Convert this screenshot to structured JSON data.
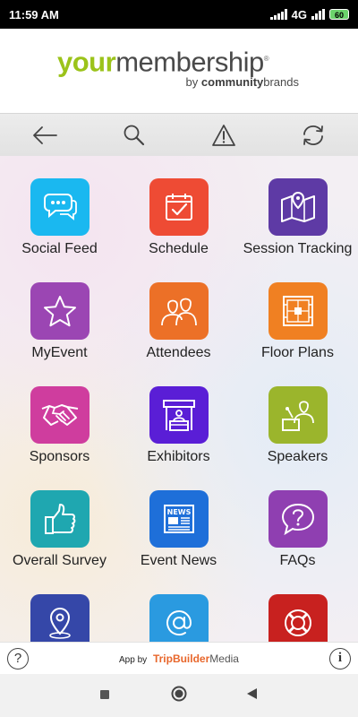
{
  "status": {
    "time": "11:59 AM",
    "network": "4G",
    "battery": "60"
  },
  "header": {
    "logo_your": "your",
    "logo_membership": "membership",
    "logo_by": "by",
    "logo_community": "community",
    "logo_brands": "brands"
  },
  "toolbar": {
    "buttons": [
      "back-arrow-icon",
      "search-icon",
      "warning-icon",
      "refresh-icon"
    ]
  },
  "tiles": [
    {
      "label": "Social Feed",
      "icon": "chat-bubbles-icon",
      "color": "#1ab8f0"
    },
    {
      "label": "Schedule",
      "icon": "calendar-check-icon",
      "color": "#ee4b34"
    },
    {
      "label": "Session Tracking",
      "icon": "map-pin-icon",
      "color": "#5e3aa5"
    },
    {
      "label": "MyEvent",
      "icon": "star-icon",
      "color": "#9b46b3"
    },
    {
      "label": "Attendees",
      "icon": "people-icon",
      "color": "#ec7027"
    },
    {
      "label": "Floor Plans",
      "icon": "floor-plan-icon",
      "color": "#f08022"
    },
    {
      "label": "Sponsors",
      "icon": "handshake-icon",
      "color": "#cf3d9e"
    },
    {
      "label": "Exhibitors",
      "icon": "booth-icon",
      "color": "#5a1ed6"
    },
    {
      "label": "Speakers",
      "icon": "speaker-podium-icon",
      "color": "#9bb52c"
    },
    {
      "label": "Overall Survey",
      "icon": "thumbs-up-icon",
      "color": "#1fa7b0"
    },
    {
      "label": "Event News",
      "icon": "newspaper-icon",
      "color": "#1e6fd9"
    },
    {
      "label": "FAQs",
      "icon": "question-bubble-icon",
      "color": "#8f3fb1"
    },
    {
      "label": "",
      "icon": "location-pin-icon",
      "color": "#3547a8"
    },
    {
      "label": "",
      "icon": "at-sign-icon",
      "color": "#2a9ae0"
    },
    {
      "label": "",
      "icon": "life-ring-icon",
      "color": "#c8211f"
    }
  ],
  "footer": {
    "help": "?",
    "app_by": "App by",
    "brand_trip": "TripBuilder",
    "brand_media": "Media",
    "info": "i"
  },
  "nav": {
    "buttons": [
      "recents-square-icon",
      "home-circle-icon",
      "back-triangle-icon"
    ]
  }
}
